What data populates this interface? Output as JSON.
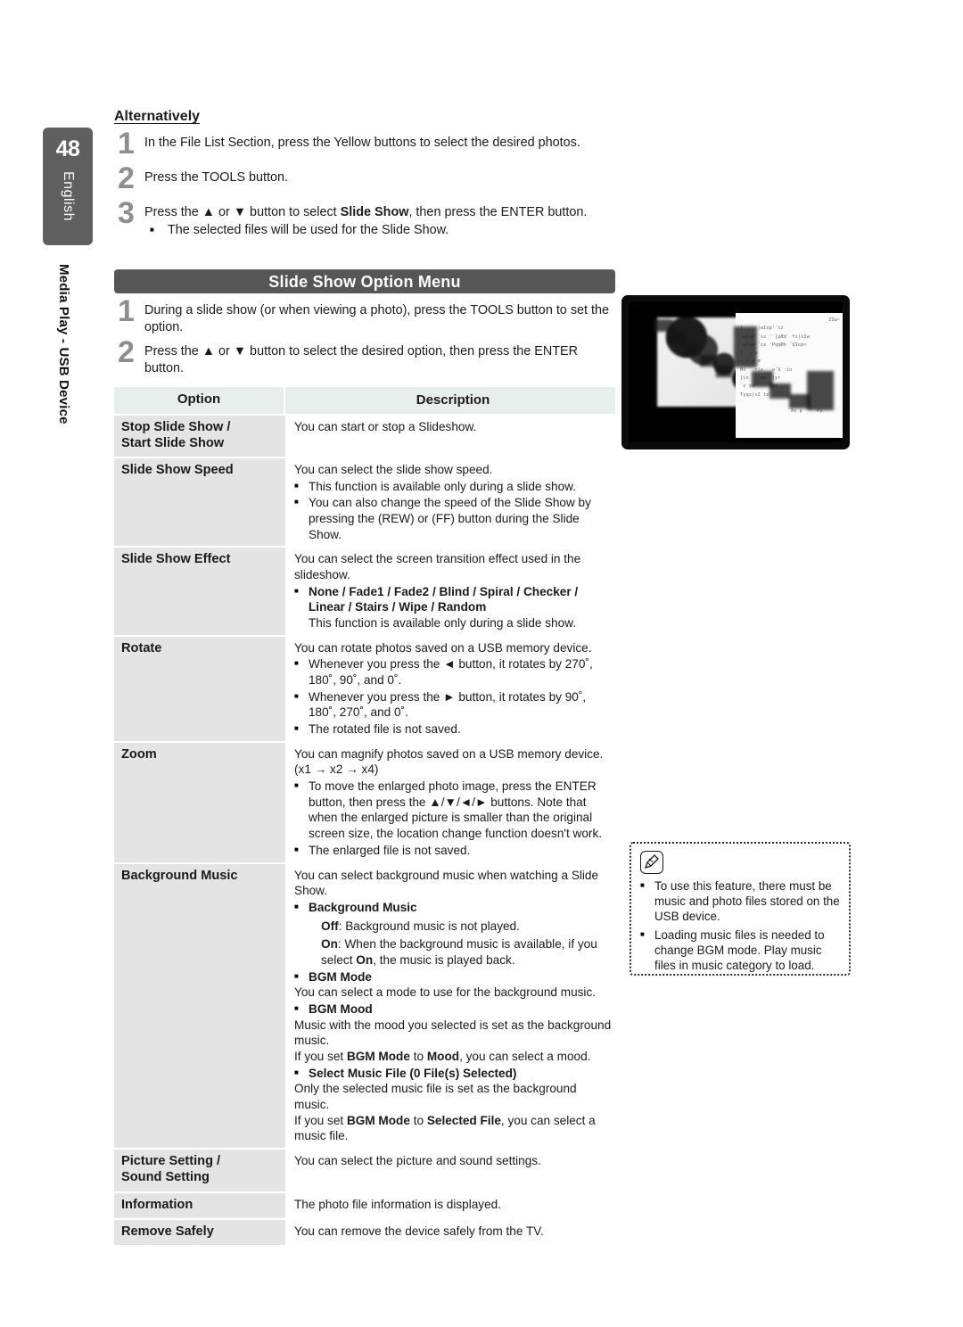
{
  "sidebar": {
    "page_number": "48",
    "language": "English",
    "chapter": "Media Play - USB Device"
  },
  "section": {
    "heading": "Alternatively"
  },
  "alternatively_steps": [
    {
      "num": "1",
      "text": "In the File List Section, press the Yellow buttons to select the desired photos.",
      "sub": null
    },
    {
      "num": "2",
      "text": "Press the TOOLS button.",
      "sub": null
    },
    {
      "num": "3",
      "text_pre": "Press the ▲ or ▼ button to select ",
      "text_bold": "Slide Show",
      "text_post": ", then press the ENTER button.",
      "sub": "The selected files will be used for the Slide Show."
    }
  ],
  "banner": {
    "title": "Slide Show Option Menu"
  },
  "menu_steps": [
    {
      "num": "1",
      "text": "During a slide show (or when viewing a photo), press the TOOLS button to set the option."
    },
    {
      "num": "2",
      "text": "Press the ▲ or ▼ button to select the desired option, then press the ENTER button."
    }
  ],
  "table": {
    "headers": {
      "option": "Option",
      "description": "Description"
    },
    "rows": [
      {
        "option": "Stop Slide Show /\nStart Slide Show",
        "lines": [
          {
            "kind": "plain",
            "text": "You can start or stop a Slideshow."
          }
        ]
      },
      {
        "option": "Slide Show Speed",
        "lines": [
          {
            "kind": "plain",
            "text": "You can select the slide show speed."
          },
          {
            "kind": "bullet",
            "text": "This function is available only during a slide show."
          },
          {
            "kind": "bullet",
            "text": "You can also change the speed of the Slide Show by pressing the        (REW) or        (FF) button during the Slide Show."
          }
        ]
      },
      {
        "option": "Slide Show Effect",
        "lines": [
          {
            "kind": "plain",
            "text": "You can select the screen transition effect used in the slideshow."
          },
          {
            "kind": "bullet-bold",
            "text": "None / Fade1 / Fade2 / Blind / Spiral / Checker / Linear / Stairs / Wipe / Random"
          },
          {
            "kind": "indent",
            "text": "This function is available only during a slide show."
          }
        ]
      },
      {
        "option": "Rotate",
        "lines": [
          {
            "kind": "plain",
            "text": "You can rotate photos saved on a USB memory device."
          },
          {
            "kind": "bullet",
            "text": "Whenever you press the ◄ button, it rotates by 270˚, 180˚, 90˚, and 0˚."
          },
          {
            "kind": "bullet",
            "text": "Whenever you press the ► button, it rotates by 90˚, 180˚, 270˚, and 0˚."
          },
          {
            "kind": "bullet",
            "text": "The rotated file is not saved."
          }
        ]
      },
      {
        "option": "Zoom",
        "lines": [
          {
            "kind": "plain",
            "text": "You can magnify photos saved on a USB memory device. (x1 → x2 → x4)"
          },
          {
            "kind": "bullet",
            "text": "To move the enlarged photo image, press the ENTER        button, then press the ▲/▼/◄/► buttons. Note that when the enlarged picture is smaller than the original screen size, the location change function doesn't work."
          },
          {
            "kind": "bullet",
            "text": "The enlarged file is not saved."
          }
        ]
      },
      {
        "option": "Background Music",
        "lines": [
          {
            "kind": "plain",
            "text": "You can select background music when watching a Slide Show."
          },
          {
            "kind": "bullet-bold",
            "text": "Background Music"
          },
          {
            "kind": "indent-mixed",
            "bold": "Off",
            "text": ": Background music is not played."
          },
          {
            "kind": "indent-mixed2",
            "bold": "On",
            "text": ": When the background music is available, if you select ",
            "bold2": "On",
            "text2": ", the music is played back."
          },
          {
            "kind": "bullet-bold",
            "text": "BGM Mode"
          },
          {
            "kind": "plain",
            "text": "You can select a mode to use for the background music."
          },
          {
            "kind": "bullet-bold",
            "text": "BGM Mood"
          },
          {
            "kind": "plain",
            "text": "Music with the mood you selected is set as the background music."
          },
          {
            "kind": "mixed-bgm-mood",
            "pre": "If you set ",
            "b1": "BGM Mode",
            "mid": " to ",
            "b2": "Mood",
            "post": ", you can select a mood."
          },
          {
            "kind": "bullet-bold",
            "text": "Select Music File (0 File(s) Selected)"
          },
          {
            "kind": "plain",
            "text": "Only the selected music file is set as the background music."
          },
          {
            "kind": "mixed-bgm-file",
            "pre": "If you set ",
            "b1": "BGM Mode",
            "mid": " to ",
            "b2": "Selected File",
            "post": ", you can select a music file."
          }
        ]
      },
      {
        "option": "Picture Setting /\nSound Setting",
        "lines": [
          {
            "kind": "plain",
            "text": "You can select the picture and sound settings."
          }
        ]
      },
      {
        "option": "Information",
        "lines": [
          {
            "kind": "plain",
            "text": "The photo file information is displayed."
          }
        ]
      },
      {
        "option": "Remove Safely",
        "lines": [
          {
            "kind": "plain",
            "text": "You can remove the device safely from the TV."
          }
        ]
      }
    ]
  },
  "note_box": {
    "icon": "note-pencil-icon",
    "items": [
      "To use this feature, there must be music and photo files stored on the USB device.",
      "Loading music files is needed to change BGM mode. Play music files in music category to load."
    ]
  },
  "tv_photo": {
    "caption": "blurred-tv-screenshot",
    "panel_lines": [
      "_ZZw~",
      "[ ´´´ |wIop'ˆsz",
      "ˆwIop'ˆsz 'ˆ[pÆd˝  Yz|xIw",
      "ˆwIop'ˆsz 'PqqØh ˝QIop<",
      "[ ´| p",
      "÷ z z æ",
      "Mí ´ r|z ´ o˝X  -ín",
      "[ín  ´|ˆæø ´|yr",
      "ˆz yd'ˆˆ´ |yr",
      "Tyqz|xI tz´",
      "´",
      "˝Xz p´´´´´Py´´´´´´"
    ]
  },
  "colors": {
    "badge_gray": "#5f5f5f",
    "banner_gray": "#565656",
    "table_header": "#e8eeec",
    "option_cell": "#e4e4e4",
    "step_number": "#8e8e8e"
  }
}
